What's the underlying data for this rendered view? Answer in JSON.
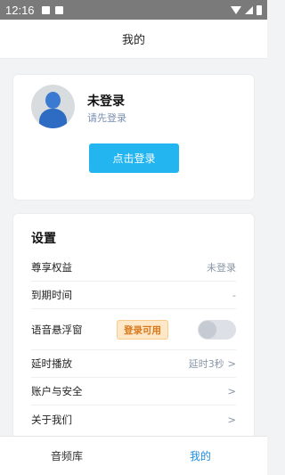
{
  "status_bar": {
    "time": "12:16"
  },
  "header": {
    "title": "我的"
  },
  "login_card": {
    "user_name": "未登录",
    "user_sub": "请先登录",
    "login_button": "点击登录"
  },
  "settings": {
    "title": "设置",
    "rows": [
      {
        "label": "尊享权益",
        "value": "未登录"
      },
      {
        "label": "到期时间",
        "value": "-"
      },
      {
        "label": "语音悬浮窗",
        "badge": "登录可用",
        "toggle_on": false
      },
      {
        "label": "延时播放",
        "value": "延时3秒",
        "arrow": ">"
      },
      {
        "label": "账户与安全",
        "arrow": ">"
      },
      {
        "label": "关于我们",
        "arrow": ">"
      }
    ]
  },
  "bottom_nav": {
    "items": [
      {
        "label": "音频库",
        "active": false
      },
      {
        "label": "我的",
        "active": true
      }
    ]
  },
  "colors": {
    "accent": "#22b5ef",
    "nav_active": "#1f8cdc",
    "badge_text": "#d9771a",
    "badge_bg": "#fde7c6"
  }
}
